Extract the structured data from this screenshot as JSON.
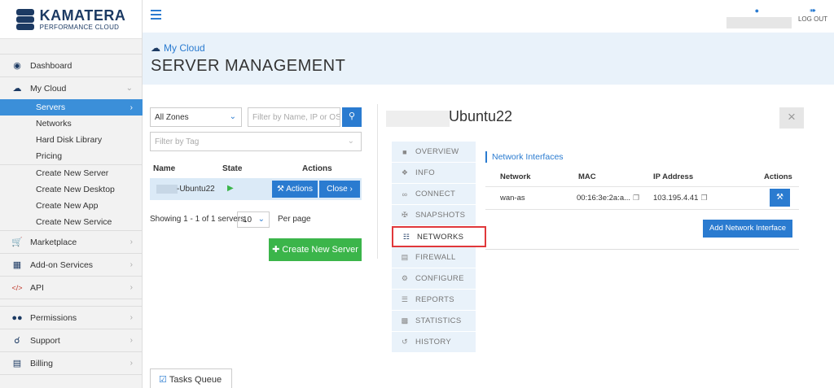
{
  "brand": {
    "name": "KAMATERA",
    "tagline": "PERFORMANCE CLOUD"
  },
  "topbar": {
    "logout": "LOG OUT",
    "menu_icon": "hamburger-icon",
    "user_icon": "user-icon",
    "logout_icon": "sign-out-icon"
  },
  "sidebar": {
    "dashboard": {
      "label": "Dashboard",
      "icon": "dashboard-icon"
    },
    "mycloud": {
      "label": "My Cloud",
      "icon": "cloud-icon"
    },
    "cloud_items": [
      "Servers",
      "Networks",
      "Hard Disk Library",
      "Pricing"
    ],
    "create_items": [
      "Create New Server",
      "Create New Desktop",
      "Create New App",
      "Create New Service"
    ],
    "marketplace": {
      "label": "Marketplace",
      "icon": "cart-icon"
    },
    "addon": {
      "label": "Add-on Services",
      "icon": "puzzle-icon"
    },
    "api": {
      "label": "API",
      "icon": "code-icon"
    },
    "permissions": {
      "label": "Permissions",
      "icon": "users-icon"
    },
    "support": {
      "label": "Support",
      "icon": "headset-icon"
    },
    "billing": {
      "label": "Billing",
      "icon": "credit-card-icon"
    }
  },
  "header": {
    "breadcrumb": "My Cloud",
    "title": "SERVER MANAGEMENT"
  },
  "list": {
    "zones_value": "All Zones",
    "filter_name_placeholder": "Filter by Name, IP or OS",
    "filter_tag_placeholder": "Filter by Tag",
    "col_name": "Name",
    "col_state": "State",
    "col_actions": "Actions",
    "server_name": "-Ubuntu22",
    "actions_btn": "Actions",
    "close_btn": "Close",
    "showing": "Showing 1 - 1 of 1 servers,",
    "per_page_value": "10",
    "per_page_label": "Per page",
    "create_btn": "Create New Server"
  },
  "detail": {
    "server_title": "Ubuntu22",
    "close_symbol": "×",
    "tabs": [
      "OVERVIEW",
      "INFO",
      "CONNECT",
      "SNAPSHOTS",
      "NETWORKS",
      "FIREWALL",
      "CONFIGURE",
      "REPORTS",
      "STATISTICS",
      "HISTORY"
    ],
    "active_tab": "NETWORKS",
    "network": {
      "title": "Network Interfaces",
      "headers": {
        "network": "Network",
        "mac": "MAC",
        "ip": "IP Address",
        "actions": "Actions"
      },
      "row": {
        "network": "wan-as",
        "mac": "00:16:3e:2a:a...",
        "ip": "103.195.4.41"
      },
      "add_btn": "Add Network Interface"
    }
  },
  "tasks": {
    "label": "Tasks Queue"
  },
  "colors": {
    "accent": "#2a7bd0",
    "success": "#3bb54a",
    "highlight": "#e0383b",
    "navy": "#1c3a63"
  }
}
